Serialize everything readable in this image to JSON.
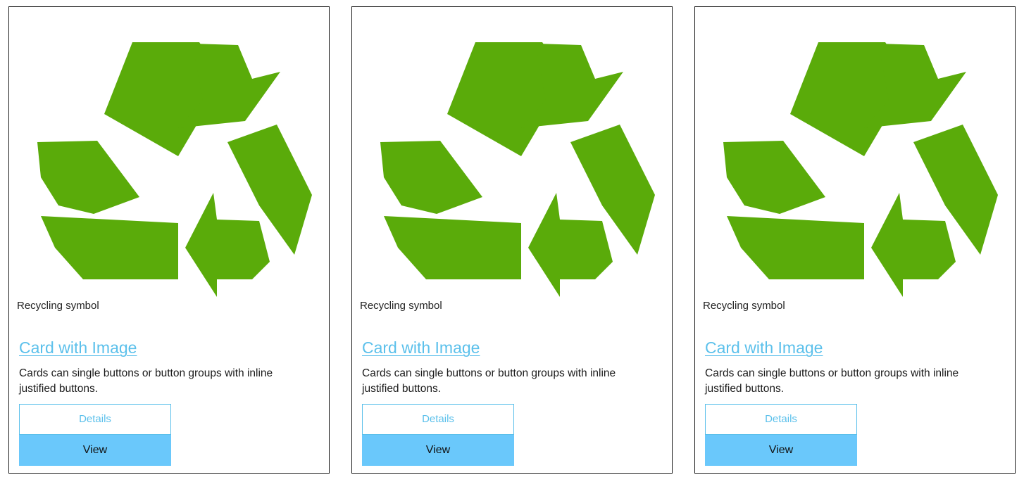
{
  "cards": [
    {
      "image_icon": "recycling-symbol-icon",
      "caption": "Recycling symbol",
      "title": "Card with Image",
      "text": "Cards can single buttons or button groups with inline justified buttons.",
      "details_label": "Details",
      "view_label": "View"
    },
    {
      "image_icon": "recycling-symbol-icon",
      "caption": "Recycling symbol",
      "title": "Card with Image",
      "text": "Cards can single buttons or button groups with inline justified buttons.",
      "details_label": "Details",
      "view_label": "View"
    },
    {
      "image_icon": "recycling-symbol-icon",
      "caption": "Recycling symbol",
      "title": "Card with Image",
      "text": "Cards can single buttons or button groups with inline justified buttons.",
      "details_label": "Details",
      "view_label": "View"
    }
  ],
  "colors": {
    "recycle_green": "#5aab0a",
    "link_blue": "#5bc0eb",
    "view_button_bg": "#6ac8fb",
    "card_border": "#1a1a1a"
  }
}
